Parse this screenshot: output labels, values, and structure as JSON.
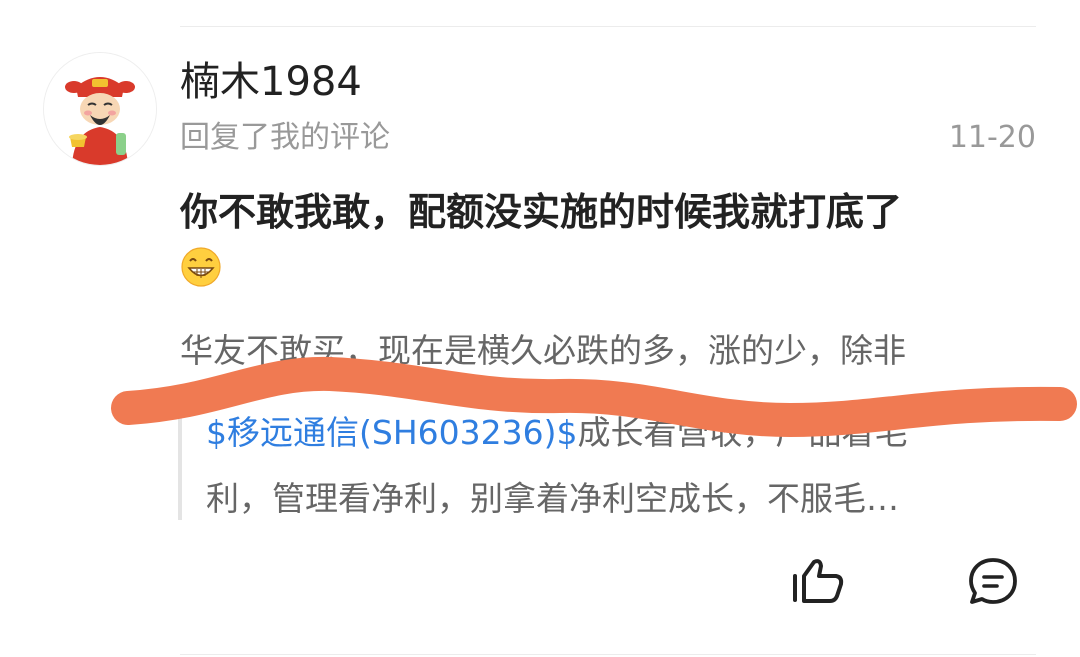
{
  "comment_card": {
    "username": "楠木1984",
    "action_text": "回复了我的评论",
    "timestamp": "11-20",
    "comment_text": "你不敢我敢，配额没实施的时候我就打底了",
    "comment_emoji": "grinning-face-icon",
    "reply_preview_text": "华友不敢买，现在是横久必跌的多，涨的少，除非",
    "quote": {
      "stock_link": "$移远通信(SH603236)$",
      "line1_rest": "成长看营收，产品看毛",
      "line2": "利，管理看净利，别拿着净利空成长，不服毛…"
    },
    "actions": {
      "like_icon": "thumbs-up-icon",
      "reply_icon": "comment-bubble-icon"
    }
  },
  "colors": {
    "link": "#2f7ee0",
    "strike_marker": "#f07a52",
    "secondary_text": "#999999",
    "primary_text": "#222222"
  }
}
